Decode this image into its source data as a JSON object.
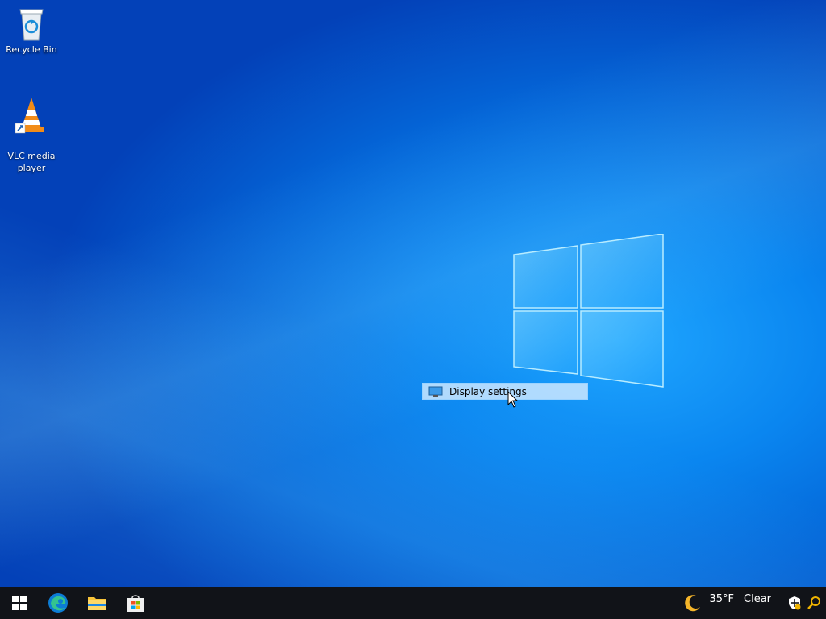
{
  "desktop": {
    "icons": [
      {
        "label": "Recycle Bin",
        "icon": "recycle-bin-icon"
      },
      {
        "label": "VLC media\nplayer",
        "icon": "vlc-cone-icon"
      }
    ]
  },
  "context_menu": {
    "items": [
      {
        "label": "Display settings",
        "icon": "monitor-icon"
      }
    ]
  },
  "taskbar": {
    "pinned": [
      {
        "name": "Start",
        "icon": "windows-logo-icon"
      },
      {
        "name": "Microsoft Edge",
        "icon": "edge-icon"
      },
      {
        "name": "File Explorer",
        "icon": "folder-icon"
      },
      {
        "name": "Microsoft Store",
        "icon": "store-bag-icon"
      }
    ],
    "weather": {
      "temp": "35°F",
      "condition": "Clear",
      "icon": "moon-icon"
    },
    "tray_icons": [
      "security-shield-icon",
      "search-icon"
    ]
  },
  "colors": {
    "accent": "#0a86f0",
    "taskbar": "#111318",
    "menu_highlight": "#cde8ff"
  }
}
